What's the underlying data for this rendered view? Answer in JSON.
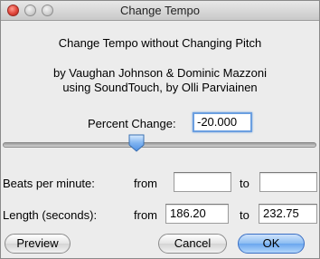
{
  "window": {
    "title": "Change Tempo"
  },
  "header": {
    "line1": "Change Tempo without Changing Pitch",
    "line2": "by Vaughan Johnson & Dominic Mazzoni",
    "line3": "using SoundTouch, by Olli Parviainen"
  },
  "percent_change": {
    "label": "Percent Change:",
    "value": "-20.000"
  },
  "bpm": {
    "label": "Beats per minute:",
    "from_label": "from",
    "from_value": "",
    "to_label": "to",
    "to_value": ""
  },
  "length": {
    "label": "Length (seconds):",
    "from_label": "from",
    "from_value": "186.20",
    "to_label": "to",
    "to_value": "232.75"
  },
  "buttons": {
    "preview": "Preview",
    "cancel": "Cancel",
    "ok": "OK"
  },
  "colors": {
    "default_button": "#6aa6ee",
    "focus_ring": "#6b9fe0",
    "close_button": "#e0443a"
  }
}
